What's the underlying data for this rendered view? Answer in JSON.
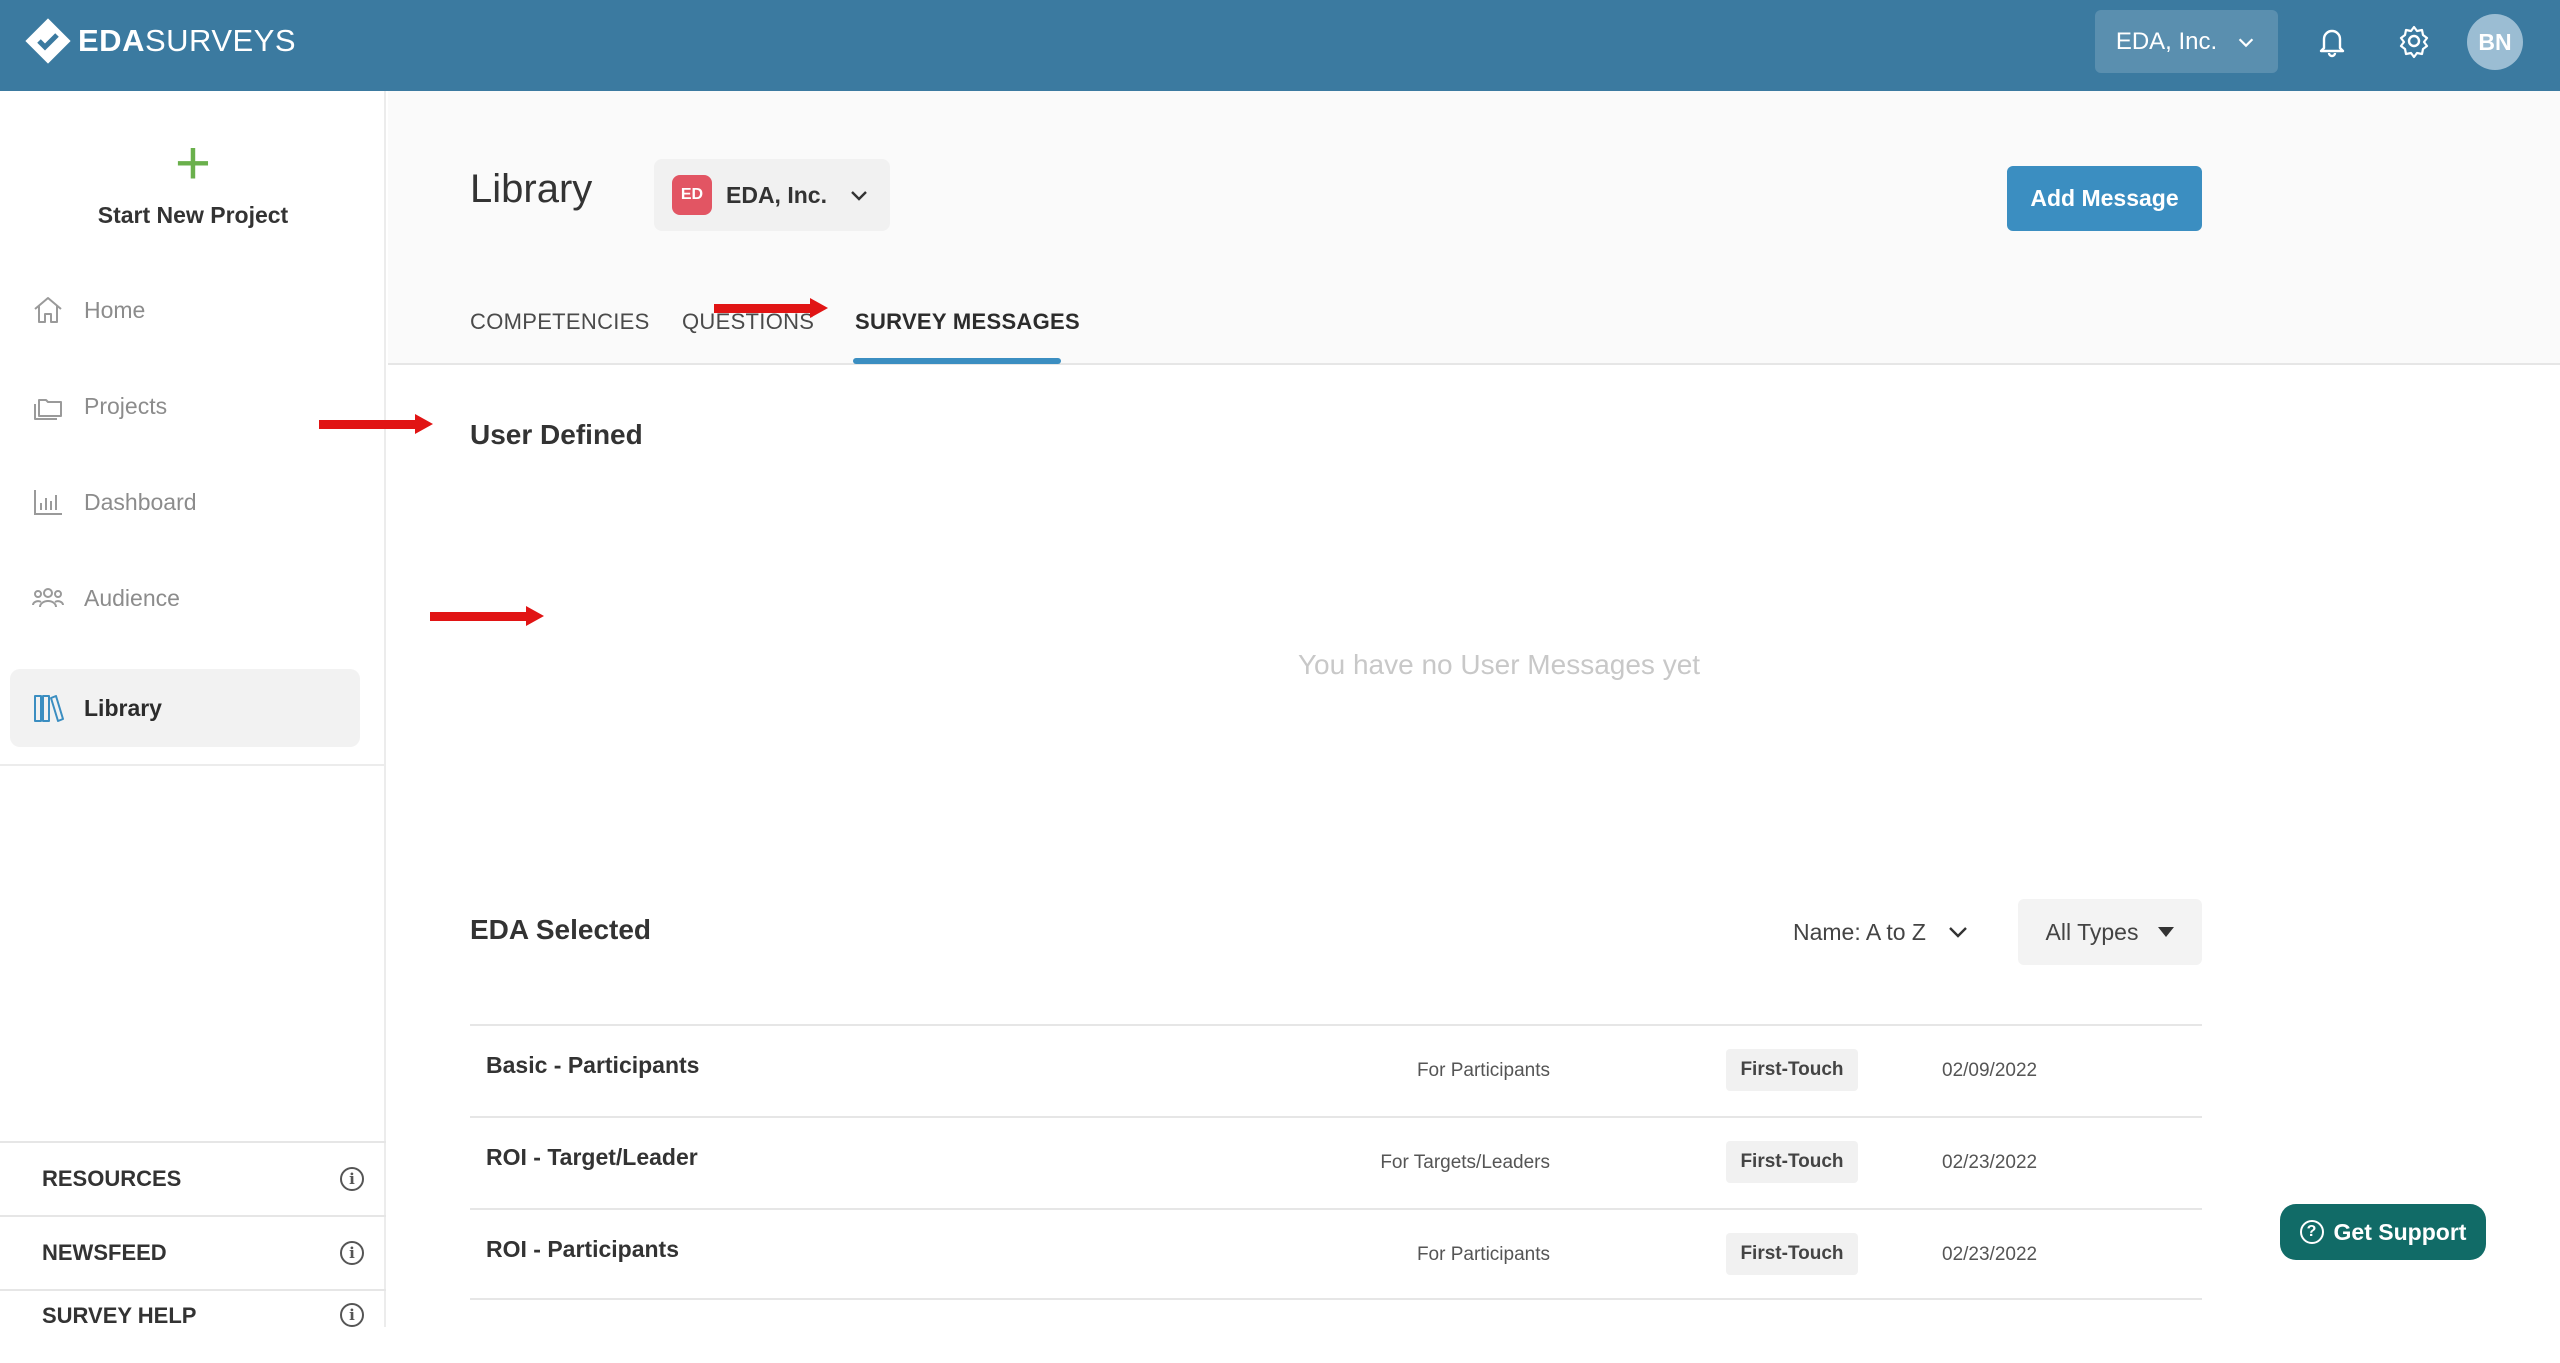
{
  "brand": {
    "logo_bold": "EDA",
    "logo_light": "SURVEYS"
  },
  "topbar": {
    "org_selector": "EDA, Inc.",
    "avatar_initials": "BN"
  },
  "sidebar": {
    "start_new_project": "Start New Project",
    "nav": {
      "home": "Home",
      "projects": "Projects",
      "dashboard": "Dashboard",
      "audience": "Audience",
      "library": "Library"
    },
    "sections": {
      "resources": "RESOURCES",
      "newsfeed": "NEWSFEED",
      "survey_help": "SURVEY HELP"
    }
  },
  "page": {
    "title": "Library",
    "company_badge": "ED",
    "company_name": "EDA, Inc.",
    "add_button": "Add Message",
    "tabs": {
      "competencies": "COMPETENCIES",
      "questions": "QUESTIONS",
      "survey_messages": "SURVEY MESSAGES"
    },
    "active_tab": "SURVEY MESSAGES",
    "user_defined": {
      "title": "User Defined",
      "empty": "You have no User Messages yet"
    },
    "eda_selected": {
      "title": "EDA Selected",
      "sort": "Name: A to Z",
      "type_filter": "All Types",
      "rows": [
        {
          "name": "Basic - Participants",
          "audience": "For Participants",
          "tag": "First-Touch",
          "date": "02/09/2022"
        },
        {
          "name": "ROI - Target/Leader",
          "audience": "For Targets/Leaders",
          "tag": "First-Touch",
          "date": "02/23/2022"
        },
        {
          "name": "ROI - Participants",
          "audience": "For Participants",
          "tag": "First-Touch",
          "date": "02/23/2022"
        }
      ]
    }
  },
  "support": {
    "label": "Get Support"
  },
  "colors": {
    "topbar": "#3b7aa0",
    "primary_button": "#3b8ec1",
    "support_button": "#116b67",
    "start_plus": "#6ab04c",
    "company_badge": "#e25563",
    "annotation_arrow": "#e11414"
  }
}
